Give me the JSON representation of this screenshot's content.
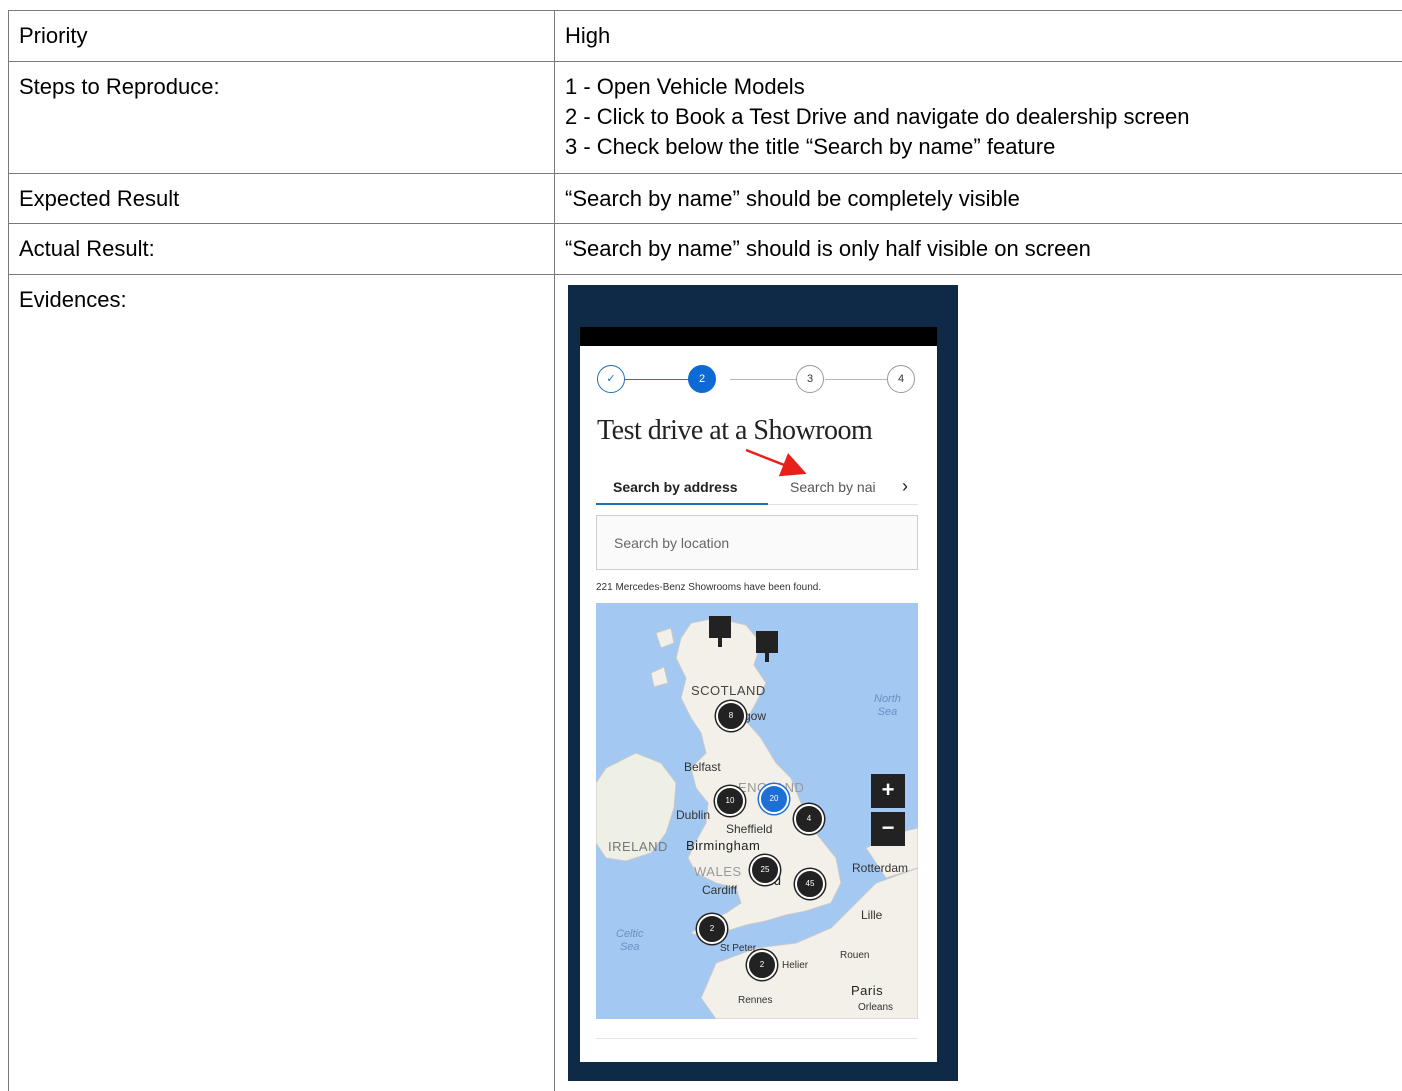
{
  "table": {
    "rows": [
      {
        "label": "Priority",
        "value": "High"
      },
      {
        "label": "Steps to Reproduce:",
        "lines": [
          "1 - Open Vehicle Models",
          "2 - Click to Book a Test Drive and navigate do dealership screen",
          "3 - Check below the title “Search by name” feature"
        ]
      },
      {
        "label": "Expected Result",
        "value": "“Search by name” should be completely visible"
      },
      {
        "label": "Actual Result:",
        "value": "“Search by name” should is only half visible on screen"
      },
      {
        "label": "Evidences:"
      }
    ]
  },
  "phone": {
    "steps": [
      "✓",
      "2",
      "3",
      "4"
    ],
    "title": "Test drive at a Showroom",
    "tabs": [
      "Search by address",
      "Search by nai"
    ],
    "tab_chevron": "›",
    "search_placeholder": "Search by location",
    "found_text": "221 Mercedes-Benz Showrooms have been found.",
    "map": {
      "labels": {
        "scotland": "SCOTLAND",
        "glasgow": "gow",
        "north_sea": "North\nSea",
        "belfast": "Belfast",
        "england": "ENGLAND",
        "dublin": "Dublin",
        "sheffield": "Sheffield",
        "ireland": "IRELAND",
        "birmingham": "Birmingham",
        "wales": "WALES",
        "london": "nd",
        "cardiff": "Cardiff",
        "rotterdam": "Rotterdam",
        "lille": "Lille",
        "celtic_sea": "Celtic\nSea",
        "st_peter": "St Peter",
        "helier": "Helier",
        "rouen": "Rouen",
        "paris": "Paris",
        "rennes": "Rennes",
        "orleans": "Orleans"
      },
      "clusters": [
        "8",
        "10",
        "20",
        "4",
        "25",
        "45",
        "2",
        "2"
      ],
      "zoom_in": "+",
      "zoom_out": "−"
    }
  }
}
